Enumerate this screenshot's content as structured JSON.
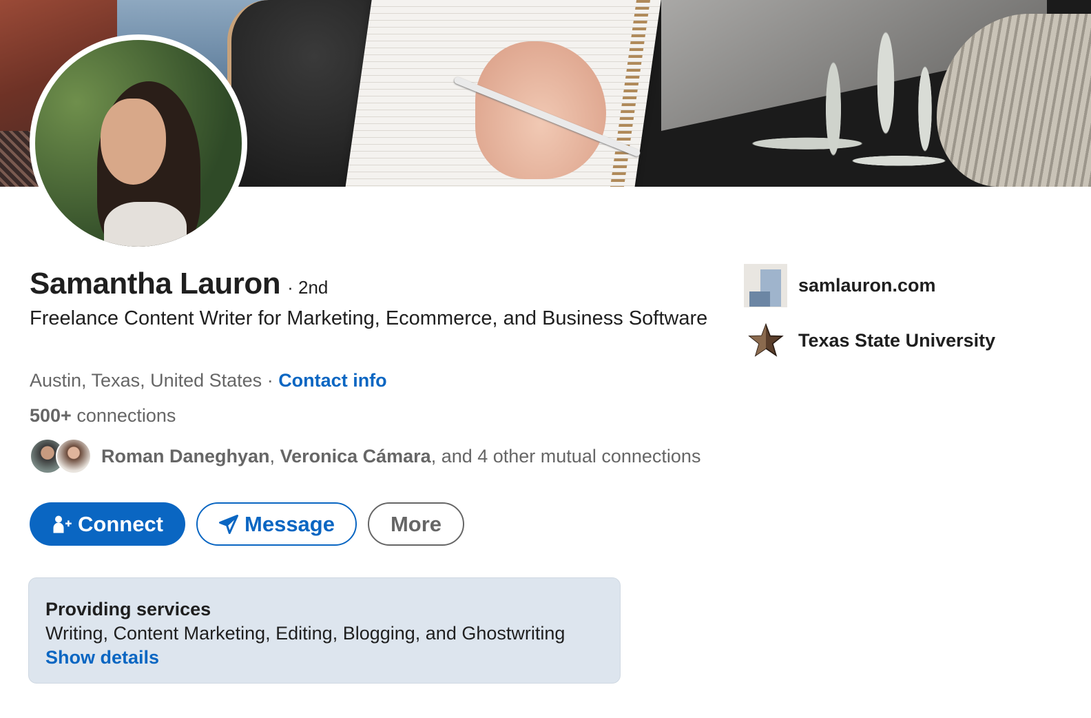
{
  "profile": {
    "name": "Samantha Lauron",
    "degree": "· 2nd",
    "headline": "Freelance Content Writer for Marketing, Ecommerce, and Business Software",
    "location": "Austin, Texas, United States",
    "location_separator": " · ",
    "contact_info_label": "Contact info",
    "connections_count": "500+",
    "connections_label": " connections"
  },
  "mutual": {
    "name1": "Roman Daneghyan",
    "sep": ", ",
    "name2": "Veronica Cámara",
    "rest": ", and 4 other mutual connections"
  },
  "actions": {
    "connect_label": "Connect",
    "message_label": "Message",
    "more_label": "More"
  },
  "services": {
    "title": "Providing services",
    "list": "Writing, Content Marketing, Editing, Blogging, and Ghostwriting",
    "link": "Show details"
  },
  "side": {
    "website": "samlauron.com",
    "school": "Texas State University"
  },
  "colors": {
    "primary": "#0a66c2",
    "text": "#1f1f1f",
    "muted": "#666666",
    "services_bg": "#dde5ee"
  },
  "icons": {
    "connect": "person-add-icon",
    "message": "send-icon",
    "school": "star-icon"
  }
}
